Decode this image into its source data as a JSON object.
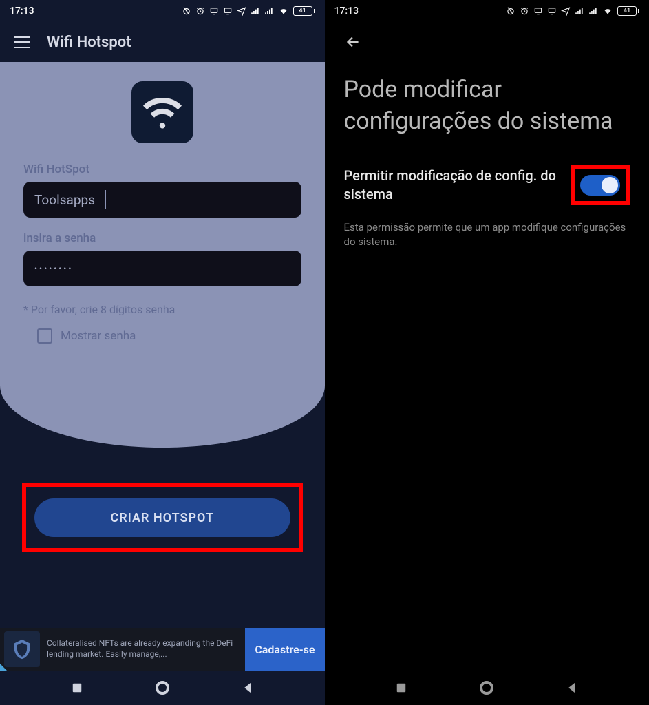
{
  "status": {
    "time": "17:13",
    "battery": "41"
  },
  "left": {
    "appTitle": "Wifi Hotspot",
    "form": {
      "ssidLabel": "Wifi HotSpot",
      "ssidValue": "Toolsapps",
      "passwordLabel": "insira a senha",
      "passwordValue": "••••••••",
      "hint": "* Por favor, crie 8 dígitos senha",
      "showPassword": "Mostrar senha"
    },
    "createBtn": "CRIAR HOTSPOT",
    "ad": {
      "text": "Collateralised NFTs are already expanding the DeFi lending market. Easily manage,...",
      "cta": "Cadastre-se"
    }
  },
  "right": {
    "heading": "Pode modificar configurações do sistema",
    "permLabel": "Permitir modificação de config. do sistema",
    "permDesc": "Esta permissão permite que um app modifique configurações do sistema."
  }
}
